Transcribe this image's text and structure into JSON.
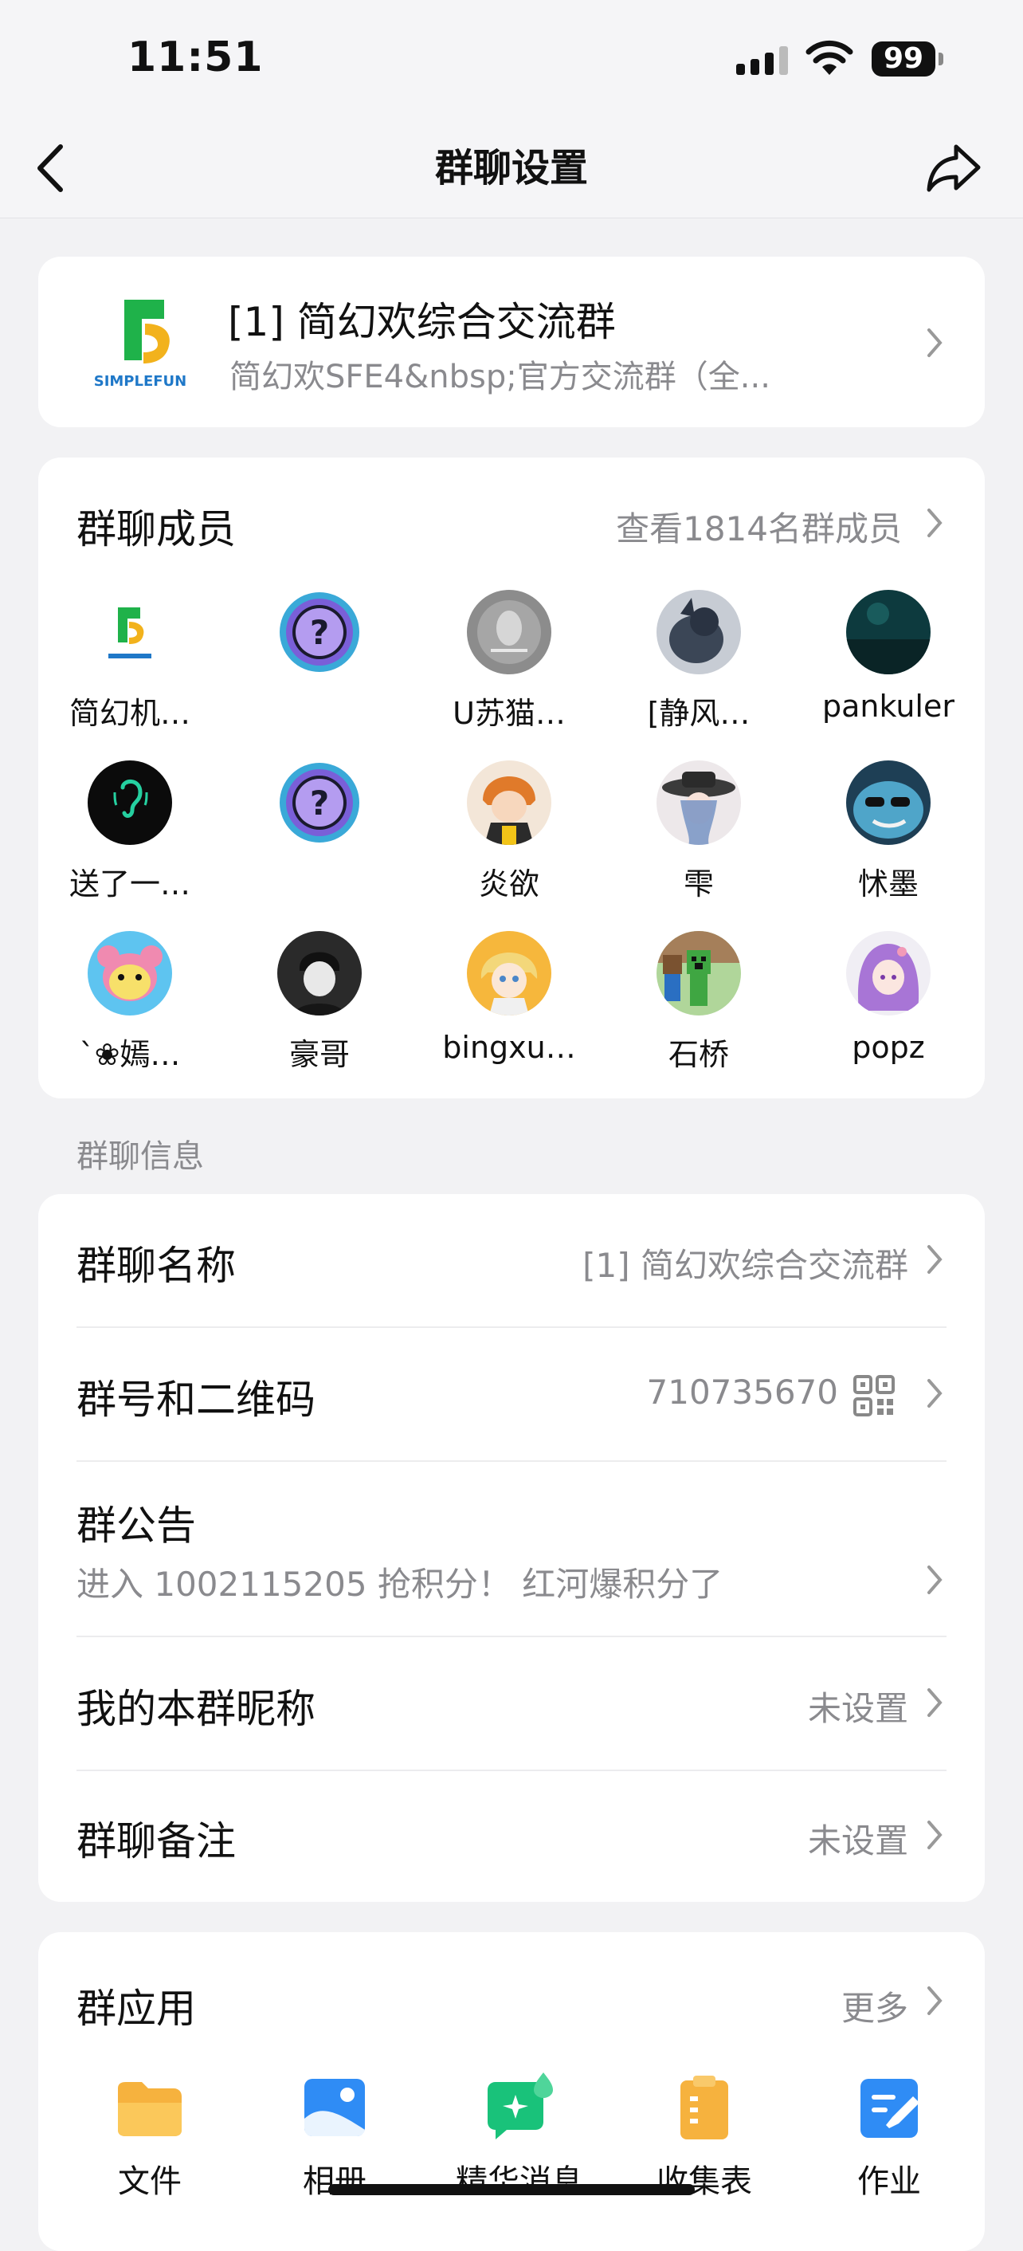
{
  "status_bar": {
    "time": "11:51",
    "battery": "99"
  },
  "nav": {
    "title": "群聊设置"
  },
  "group": {
    "logo_text": "SIMPLEFUN",
    "name": "[1] 简幻欢综合交流群",
    "description": "简幻欢SFE4&nbsp;官方交流群（全..."
  },
  "members": {
    "title": "群聊成员",
    "view_all": "查看1814名群成员",
    "list": [
      {
        "name": "简幻机…",
        "avatar": "simplefun-logo"
      },
      {
        "name": "",
        "avatar": "question-badge"
      },
      {
        "name": "U苏猫…",
        "avatar": "grey-portrait"
      },
      {
        "name": "[静风…",
        "avatar": "bird-photo"
      },
      {
        "name": "pankuler",
        "avatar": "dark-teal-scene"
      },
      {
        "name": "送了一…",
        "avatar": "green-ear"
      },
      {
        "name": "",
        "avatar": "question-badge"
      },
      {
        "name": "炎欲",
        "avatar": "anime-orange-hair"
      },
      {
        "name": "雫",
        "avatar": "anime-hat"
      },
      {
        "name": "怵墨",
        "avatar": "shark-sunglasses"
      },
      {
        "name": "`❀嫣…",
        "avatar": "pink-pixel-bear"
      },
      {
        "name": "豪哥",
        "avatar": "dark-portrait"
      },
      {
        "name": "bingxu…",
        "avatar": "anime-blond"
      },
      {
        "name": "石桥",
        "avatar": "minecraft-creeper"
      },
      {
        "name": "popz",
        "avatar": "anime-purple"
      }
    ]
  },
  "info_section": {
    "label": "群聊信息",
    "group_name_label": "群聊名称",
    "group_name_value": "[1] 简幻欢综合交流群",
    "group_id_label": "群号和二维码",
    "group_id_value": "710735670",
    "notice_label": "群公告",
    "notice_value": "进入 1002115205 抢积分！ 红河爆积分了",
    "nickname_label": "我的本群昵称",
    "nickname_value": "未设置",
    "remark_label": "群聊备注",
    "remark_value": "未设置"
  },
  "apps": {
    "title": "群应用",
    "more": "更多",
    "items": [
      {
        "label": "文件",
        "icon": "folder-icon",
        "color": "#f6b23e"
      },
      {
        "label": "相册",
        "icon": "photo-album-icon",
        "color": "#2f8cf5"
      },
      {
        "label": "精华消息",
        "icon": "essence-message-icon",
        "color": "#19c27a"
      },
      {
        "label": "收集表",
        "icon": "clipboard-icon",
        "color": "#f6b23e"
      },
      {
        "label": "作业",
        "icon": "homework-icon",
        "color": "#2f8cf5"
      }
    ]
  }
}
